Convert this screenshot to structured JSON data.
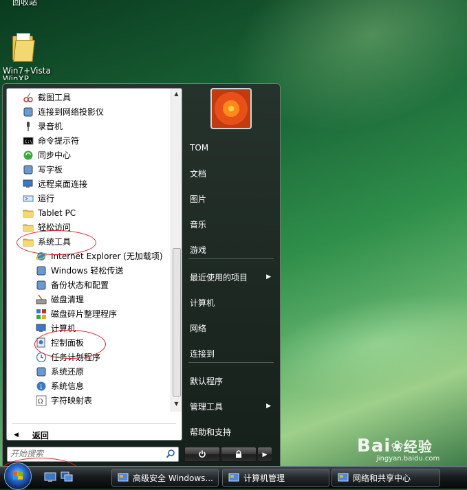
{
  "desktop": {
    "top_icon_label": "回收站",
    "folder_label": "Win7+Vista",
    "folder_label_2": "WinXP"
  },
  "programs": {
    "items": [
      {
        "label": "截图工具",
        "icon": "snipping-tool-icon",
        "level": 0
      },
      {
        "label": "连接到网络投影仪",
        "icon": "network-projector-icon",
        "level": 0
      },
      {
        "label": "录音机",
        "icon": "microphone-icon",
        "level": 0
      },
      {
        "label": "命令提示符",
        "icon": "command-prompt-icon",
        "level": 0
      },
      {
        "label": "同步中心",
        "icon": "sync-center-icon",
        "level": 0
      },
      {
        "label": "写字板",
        "icon": "wordpad-icon",
        "level": 0
      },
      {
        "label": "远程桌面连接",
        "icon": "remote-desktop-icon",
        "level": 0
      },
      {
        "label": "运行",
        "icon": "run-icon",
        "level": 0
      },
      {
        "label": "Tablet PC",
        "icon": "folder-icon",
        "level": 0
      },
      {
        "label": "轻松访问",
        "icon": "folder-icon",
        "level": 0
      },
      {
        "label": "系统工具",
        "icon": "folder-icon",
        "level": 0
      },
      {
        "label": "Internet Explorer (无加载项)",
        "icon": "internet-explorer-icon",
        "level": 1
      },
      {
        "label": "Windows 轻松传送",
        "icon": "easy-transfer-icon",
        "level": 1
      },
      {
        "label": "备份状态和配置",
        "icon": "backup-icon",
        "level": 1
      },
      {
        "label": "磁盘清理",
        "icon": "disk-cleanup-icon",
        "level": 1
      },
      {
        "label": "磁盘碎片整理程序",
        "icon": "defragmenter-icon",
        "level": 1
      },
      {
        "label": "计算机",
        "icon": "computer-icon",
        "level": 1
      },
      {
        "label": "控制面板",
        "icon": "control-panel-icon",
        "level": 1
      },
      {
        "label": "任务计划程序",
        "icon": "task-scheduler-icon",
        "level": 1
      },
      {
        "label": "系统还原",
        "icon": "system-restore-icon",
        "level": 1
      },
      {
        "label": "系统信息",
        "icon": "system-info-icon",
        "level": 1
      },
      {
        "label": "字符映射表",
        "icon": "character-map-icon",
        "level": 1
      }
    ],
    "back_label": "返回"
  },
  "search": {
    "placeholder": "开始搜索"
  },
  "right_pane": {
    "user_name": "TOM",
    "items": [
      {
        "label": "文档",
        "has_arrow": false
      },
      {
        "label": "图片",
        "has_arrow": false
      },
      {
        "label": "音乐",
        "has_arrow": false
      },
      {
        "label": "游戏",
        "has_arrow": false
      },
      {
        "label": "最近使用的项目",
        "has_arrow": true
      },
      {
        "label": "计算机",
        "has_arrow": false
      },
      {
        "label": "网络",
        "has_arrow": false
      },
      {
        "label": "连接到",
        "has_arrow": false
      },
      {
        "label": "默认程序",
        "has_arrow": false
      },
      {
        "label": "管理工具",
        "has_arrow": true
      },
      {
        "label": "帮助和支持",
        "has_arrow": false
      }
    ]
  },
  "power": {
    "power_icon": "power-icon",
    "lock_icon": "lock-icon",
    "arrow_icon": "chevron-right-icon"
  },
  "taskbar": {
    "buttons": [
      {
        "label": "高级安全 Windows...",
        "icon": "firewall-icon"
      },
      {
        "label": "计算机管理",
        "icon": "computer-management-icon"
      },
      {
        "label": "网络和共享中心",
        "icon": "network-sharing-icon"
      }
    ]
  },
  "watermark": {
    "main": "Bai",
    "main_2": "经验",
    "sub": "jingyan.baidu.com"
  },
  "colors": {
    "annotation": "#e0202a",
    "menu_bg": "#1d2722",
    "menu_text": "#ffffff"
  }
}
